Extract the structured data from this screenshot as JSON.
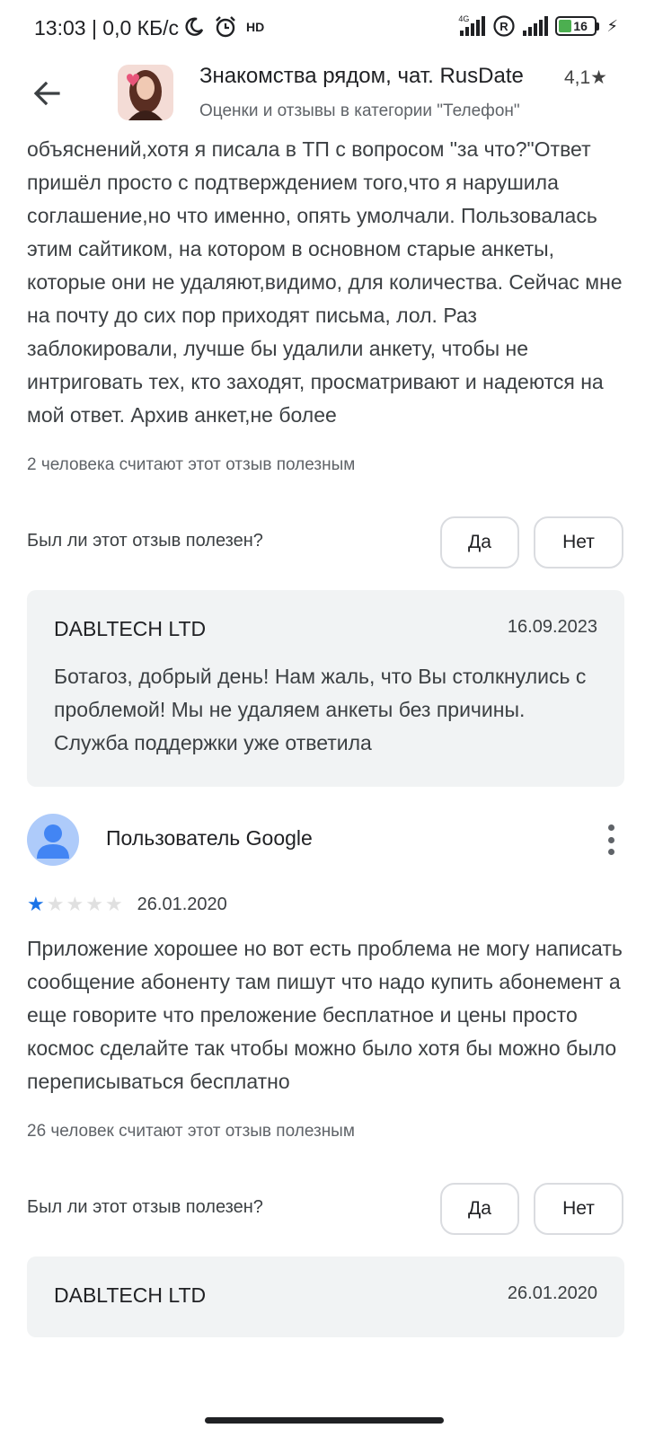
{
  "status_bar": {
    "time": "13:03 | 0,0 КБ/с",
    "net_label": "4G",
    "hd_label": "HD",
    "battery": "16"
  },
  "header": {
    "app_title": "Знакомства рядом, чат. RusDate",
    "rating": "4,1★",
    "subtitle": "Оценки и отзывы в категории \"Телефон\""
  },
  "reviews": [
    {
      "text": "объяснений,хотя я писала в ТП с вопросом \"за что?\"Ответ пришёл просто с подтверждением того,что я нарушила соглашение,но что именно, опять умолчали. Пользовалась этим сайтиком, на котором в основном старые анкеты, которые они не удаляют,видимо, для количества. Сейчас мне на почту до сих пор приходят письма, лол. Раз заблокировали, лучше бы удалили анкету, чтобы не интриговать тех, кто заходят, просматривают и надеются на мой ответ. Архив анкет,не более",
      "helpful_count": "2 человека считают этот отзыв полезным",
      "helpful_question": "Был ли этот отзыв полезен?",
      "yes": "Да",
      "no": "Нет",
      "reply": {
        "developer": "DABLTECH LTD",
        "date": "16.09.2023",
        "text": "Ботагоз, добрый день! Нам жаль, что Вы столкнулись с проблемой! Мы не удаляем анкеты без причины. Служба поддержки уже ответила"
      }
    },
    {
      "user": "Пользователь Google",
      "stars": 1,
      "date": "26.01.2020",
      "text": "Приложение хорошее но вот есть проблема не могу написать сообщение абоненту там пишут что надо купить абонемент а еще говорите что преложение бесплатное и цены просто космос сделайте так чтобы можно было хотя бы можно было переписываться бесплатно",
      "helpful_count": "26 человек считают этот отзыв полезным",
      "helpful_question": "Был ли этот отзыв полезен?",
      "yes": "Да",
      "no": "Нет",
      "reply": {
        "developer": "DABLTECH LTD",
        "date": "26.01.2020"
      }
    }
  ],
  "colors": {
    "star_on": "#1a73e8",
    "reply_bg": "#f1f3f4",
    "avatar_bg": "#aecbfa"
  }
}
